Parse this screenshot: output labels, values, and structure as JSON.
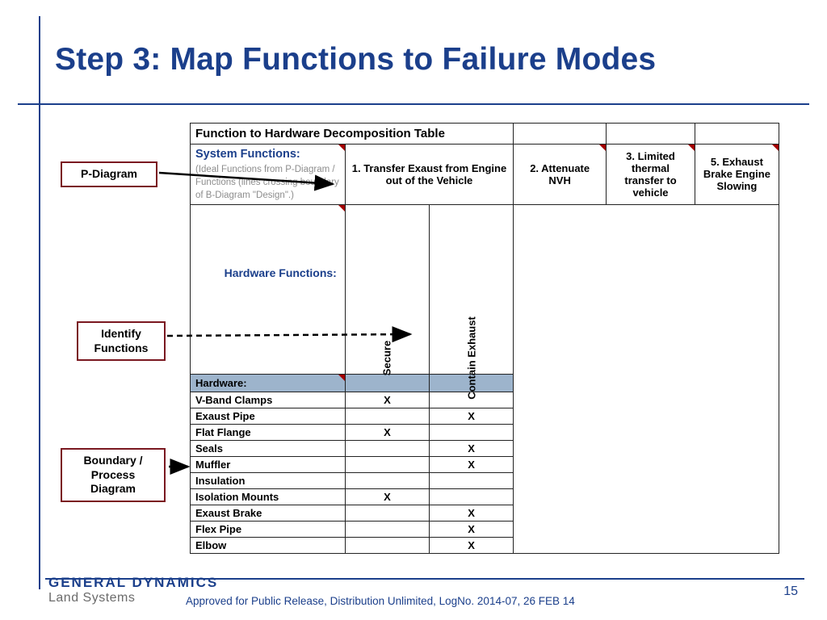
{
  "title": "Step 3: Map Functions to Failure Modes",
  "callouts": {
    "pdiagram": "P-Diagram",
    "identify": "Identify Functions",
    "boundary": "Boundary / Process Diagram"
  },
  "table": {
    "header_title": "Function to Hardware Decomposition Table",
    "sys_func_label": "System Functions:",
    "sys_func_note": "(Ideal Functions from P-Diagram / Functions (lines crossing boundary of B-Diagram \"Design\".)",
    "sys_funcs": {
      "f1": "1. Transfer Exaust from Engine out of the Vehicle",
      "f2": "2. Attenuate NVH",
      "f3": "3. Limited thermal transfer to vehicle",
      "f5": "5. Exhaust Brake Engine Slowing"
    },
    "hw_func_label": "Hardware Functions:",
    "hw_func_cols": {
      "c1": "Secure",
      "c2": "Contain Exhaust"
    },
    "hw_header": "Hardware:",
    "rows": [
      {
        "name": "V-Band Clamps",
        "c1": "X",
        "c2": ""
      },
      {
        "name": "Exaust Pipe",
        "c1": "",
        "c2": "X"
      },
      {
        "name": "Flat Flange",
        "c1": "X",
        "c2": ""
      },
      {
        "name": "Seals",
        "c1": "",
        "c2": "X"
      },
      {
        "name": "Muffler",
        "c1": "",
        "c2": "X"
      },
      {
        "name": "Insulation",
        "c1": "",
        "c2": ""
      },
      {
        "name": "Isolation Mounts",
        "c1": "X",
        "c2": ""
      },
      {
        "name": "Exaust Brake",
        "c1": "",
        "c2": "X"
      },
      {
        "name": "Flex Pipe",
        "c1": "",
        "c2": "X"
      },
      {
        "name": "Elbow",
        "c1": "",
        "c2": "X"
      }
    ]
  },
  "footer": {
    "logo_top": "GENERAL DYNAMICS",
    "logo_bot": "Land Systems",
    "release": "Approved for Public Release, Distribution Unlimited, LogNo. 2014-07, 26 FEB 14",
    "page": "15"
  }
}
